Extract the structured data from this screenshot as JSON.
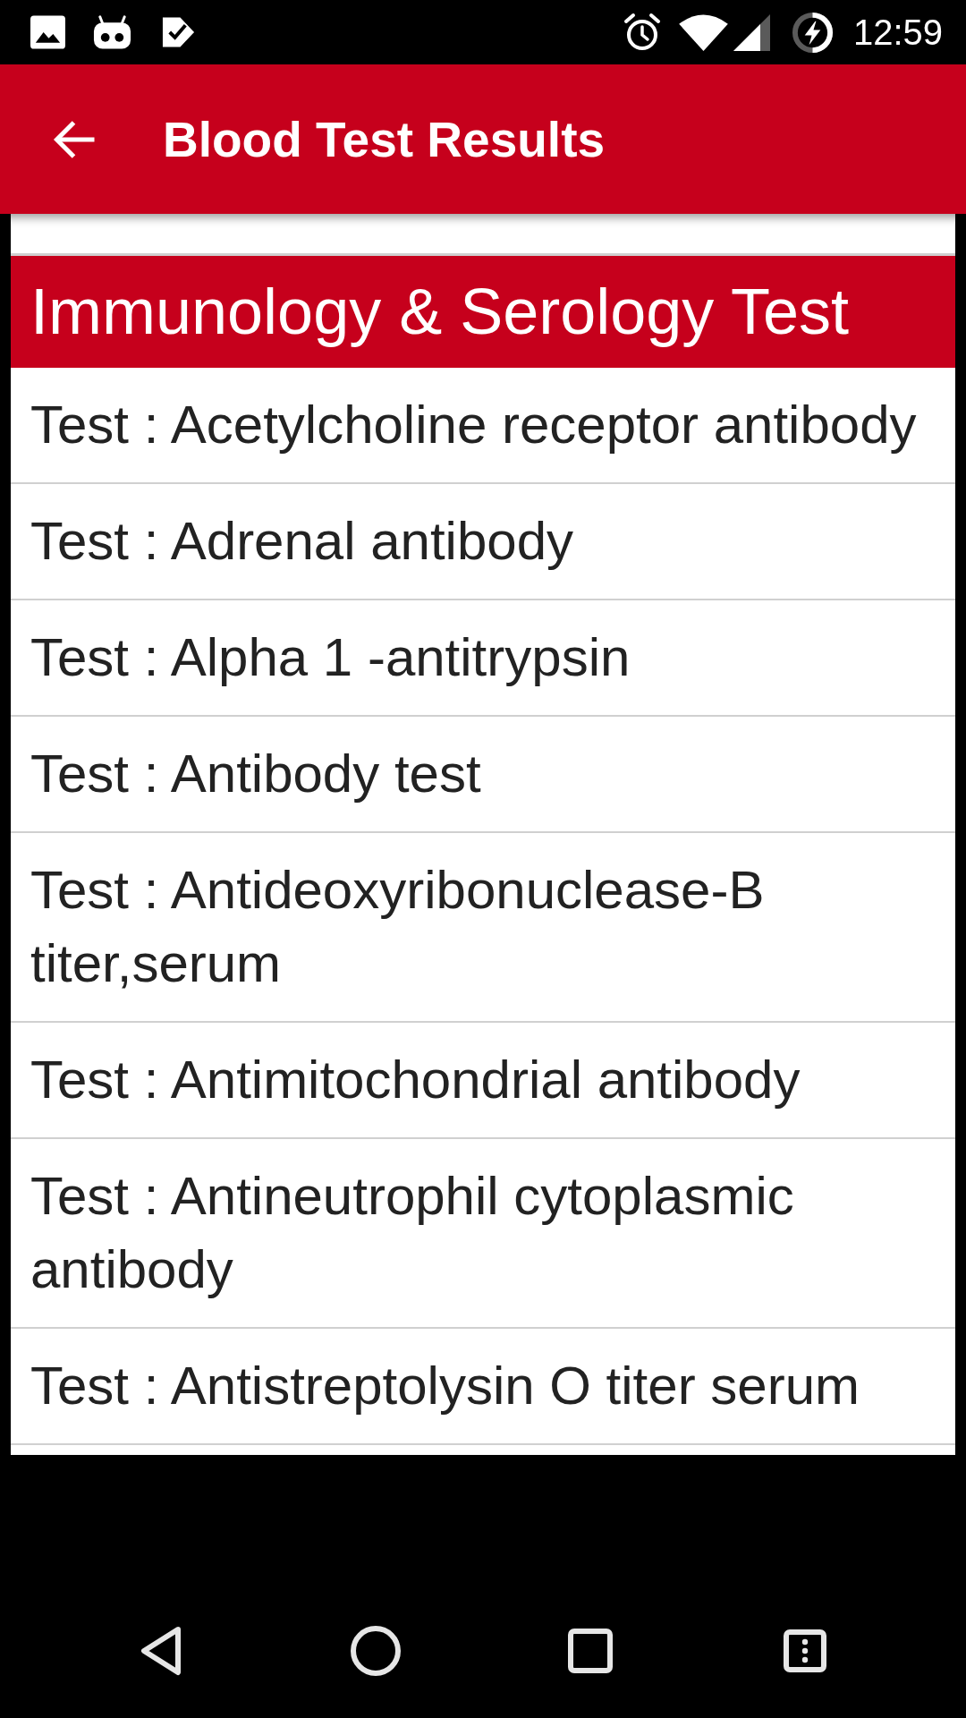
{
  "status_bar": {
    "time": "12:59"
  },
  "app_bar": {
    "title": "Blood Test Results"
  },
  "list": {
    "section_title": "Immunology & Serology Test",
    "items": [
      "Test : Acetylcholine receptor antibody",
      "Test : Adrenal antibody",
      "Test : Alpha 1 -antitrypsin",
      "Test : Antibody test",
      "Test : Antideoxyribonuclease-B titer,serum",
      "Test : Antimitochondrial antibody",
      "Test : Antineutrophil cytoplasmic antibody",
      "Test : Antistreptolysin O titer serum"
    ]
  }
}
